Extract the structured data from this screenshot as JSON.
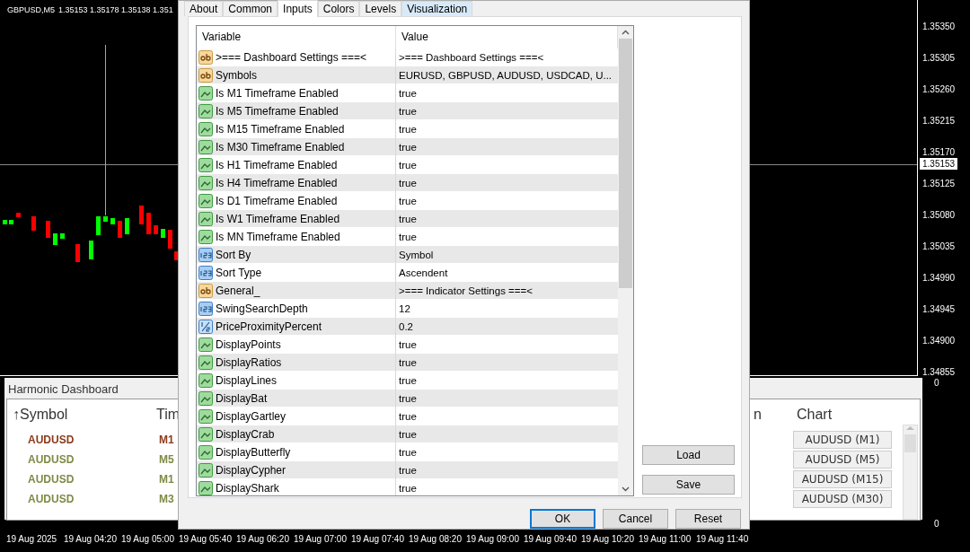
{
  "chart": {
    "symbol": "GBPUSD,M5",
    "quote": "1.35153 1.35178 1.35138 1.351"
  },
  "price_axis": {
    "labels": [
      "1.35350",
      "1.35305",
      "1.35260",
      "1.35215",
      "1.35170",
      "1.35125",
      "1.35080",
      "1.35035",
      "1.34990",
      "1.34945",
      "1.34900",
      "1.34855"
    ],
    "current_price": "1.35153"
  },
  "subwindow_axis": [
    "0",
    "0"
  ],
  "time_axis": [
    "19 Aug 2025",
    "19 Aug 04:20",
    "19 Aug 05:00",
    "19 Aug 05:40",
    "19 Aug 06:20",
    "19 Aug 07:00",
    "19 Aug 07:40",
    "19 Aug 08:20",
    "19 Aug 09:00",
    "19 Aug 09:40",
    "19 Aug 10:20",
    "19 Aug 11:00",
    "19 Aug 11:40"
  ],
  "dashboard": {
    "title": "Harmonic Dashboard",
    "columns": [
      "↑Symbol",
      "Tim",
      "n",
      "Chart"
    ],
    "rows": [
      {
        "symbol": "AUDUSD",
        "timeframe": "M1",
        "chart_button": "AUDUSD (M1)",
        "color": "#8b3a1a"
      },
      {
        "symbol": "AUDUSD",
        "timeframe": "M5",
        "chart_button": "AUDUSD (M5)",
        "color": "#7f8a45"
      },
      {
        "symbol": "AUDUSD",
        "timeframe": "M1",
        "chart_button": "AUDUSD (M15)",
        "color": "#7f8a45"
      },
      {
        "symbol": "AUDUSD",
        "timeframe": "M3",
        "chart_button": "AUDUSD (M30)",
        "color": "#7f8a45"
      }
    ]
  },
  "dialog": {
    "tabs": [
      {
        "label": "About",
        "selected": false,
        "hovered": false
      },
      {
        "label": "Common",
        "selected": false,
        "hovered": false
      },
      {
        "label": "Inputs",
        "selected": true,
        "hovered": false
      },
      {
        "label": "Colors",
        "selected": false,
        "hovered": false
      },
      {
        "label": "Levels",
        "selected": false,
        "hovered": false
      },
      {
        "label": "Visualization",
        "selected": false,
        "hovered": true
      }
    ],
    "table": {
      "columns": [
        "Variable",
        "Value"
      ],
      "rows": [
        {
          "kind": "string",
          "variable": ">=== Dashboard Settings ===<",
          "value": ">=== Dashboard Settings ===<"
        },
        {
          "kind": "string",
          "variable": "Symbols",
          "value": "EURUSD, GBPUSD, AUDUSD, USDCAD, U..."
        },
        {
          "kind": "bool",
          "variable": "Is M1 Timeframe Enabled",
          "value": "true"
        },
        {
          "kind": "bool",
          "variable": "Is M5 Timeframe Enabled",
          "value": "true"
        },
        {
          "kind": "bool",
          "variable": "Is M15 Timeframe Enabled",
          "value": "true"
        },
        {
          "kind": "bool",
          "variable": "Is M30 Timeframe Enabled",
          "value": "true"
        },
        {
          "kind": "bool",
          "variable": "Is H1 Timeframe Enabled",
          "value": "true"
        },
        {
          "kind": "bool",
          "variable": "Is H4 Timeframe Enabled",
          "value": "true"
        },
        {
          "kind": "bool",
          "variable": "Is D1 Timeframe Enabled",
          "value": "true"
        },
        {
          "kind": "bool",
          "variable": "Is W1 Timeframe Enabled",
          "value": "true"
        },
        {
          "kind": "bool",
          "variable": "Is MN Timeframe Enabled",
          "value": "true"
        },
        {
          "kind": "int",
          "variable": "Sort By",
          "value": "Symbol"
        },
        {
          "kind": "int",
          "variable": "Sort Type",
          "value": "Ascendent"
        },
        {
          "kind": "string",
          "variable": "General_",
          "value": ">=== Indicator Settings ===<"
        },
        {
          "kind": "int",
          "variable": "SwingSearchDepth",
          "value": "12"
        },
        {
          "kind": "double",
          "variable": "PriceProximityPercent",
          "value": "0.2"
        },
        {
          "kind": "bool",
          "variable": "DisplayPoints",
          "value": "true"
        },
        {
          "kind": "bool",
          "variable": "DisplayRatios",
          "value": "true"
        },
        {
          "kind": "bool",
          "variable": "DisplayLines",
          "value": "true"
        },
        {
          "kind": "bool",
          "variable": "DisplayBat",
          "value": "true"
        },
        {
          "kind": "bool",
          "variable": "DisplayGartley",
          "value": "true"
        },
        {
          "kind": "bool",
          "variable": "DisplayCrab",
          "value": "true"
        },
        {
          "kind": "bool",
          "variable": "DisplayButterfly",
          "value": "true"
        },
        {
          "kind": "bool",
          "variable": "DisplayCypher",
          "value": "true"
        },
        {
          "kind": "bool",
          "variable": "DisplayShark",
          "value": "true"
        }
      ]
    },
    "side_buttons": [
      "Load",
      "Save"
    ],
    "buttons": [
      {
        "label": "OK",
        "focused": true
      },
      {
        "label": "Cancel",
        "focused": false
      },
      {
        "label": "Reset",
        "focused": false
      }
    ]
  }
}
